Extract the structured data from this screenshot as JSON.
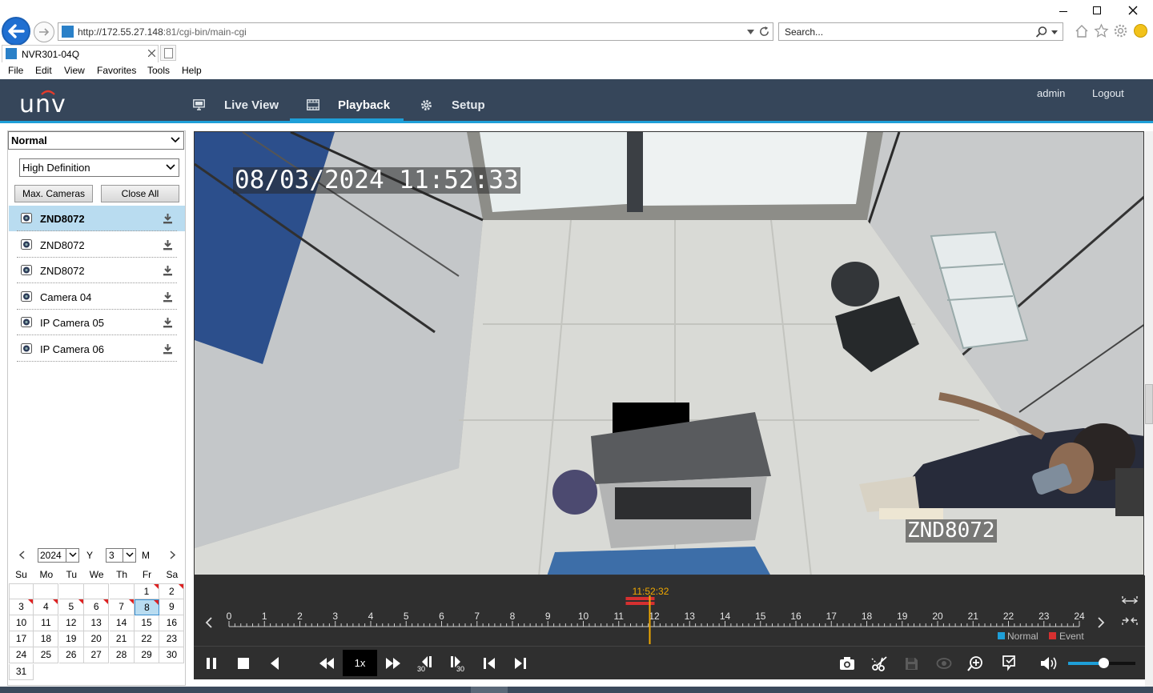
{
  "browser": {
    "url_host": "http://172.55.27.148",
    "url_rest": ":81/cgi-bin/main-cgi",
    "search_placeholder": "Search...",
    "tab_title": "NVR301-04Q",
    "menu": [
      "File",
      "Edit",
      "View",
      "Favorites",
      "Tools",
      "Help"
    ]
  },
  "app": {
    "logo": "unv",
    "nav": [
      {
        "label": "Live View",
        "icon": "monitor-icon"
      },
      {
        "label": "Playback",
        "icon": "film-icon",
        "active": true
      },
      {
        "label": "Setup",
        "icon": "gear-icon"
      }
    ],
    "user": "admin",
    "logout": "Logout"
  },
  "left": {
    "mode": "Normal",
    "quality": "High Definition",
    "max_cameras_label": "Max. Cameras",
    "close_all_label": "Close All",
    "cameras": [
      {
        "name": "ZND8072",
        "active": true
      },
      {
        "name": "ZND8072"
      },
      {
        "name": "ZND8072"
      },
      {
        "name": "Camera 04"
      },
      {
        "name": "IP Camera 05"
      },
      {
        "name": "IP Camera 06"
      }
    ]
  },
  "calendar": {
    "year": "2024",
    "year_suffix": "Y",
    "month": "3",
    "month_suffix": "M",
    "weekdays": [
      "Su",
      "Mo",
      "Tu",
      "We",
      "Th",
      "Fr",
      "Sa"
    ],
    "days": [
      "",
      "",
      "",
      "",
      "",
      "1",
      "2",
      "3",
      "4",
      "5",
      "6",
      "7",
      "8",
      "9",
      "10",
      "11",
      "12",
      "13",
      "14",
      "15",
      "16",
      "17",
      "18",
      "19",
      "20",
      "21",
      "22",
      "23",
      "24",
      "25",
      "26",
      "27",
      "28",
      "29",
      "30",
      "31"
    ],
    "recorded_days": [
      "1",
      "2",
      "3",
      "4",
      "5",
      "6",
      "7",
      "8"
    ],
    "selected_day": "8"
  },
  "video": {
    "timestamp_osd": "08/03/2024 11:52:33",
    "camera_osd": "ZND8072"
  },
  "timeline": {
    "current_time": "11:52:32",
    "hours": [
      "0",
      "1",
      "2",
      "3",
      "4",
      "5",
      "6",
      "7",
      "8",
      "9",
      "10",
      "11",
      "12",
      "13",
      "14",
      "15",
      "16",
      "17",
      "18",
      "19",
      "20",
      "21",
      "22",
      "23",
      "24"
    ],
    "legend_normal": "Normal",
    "legend_event": "Event",
    "colors": {
      "normal": "#1e9fd8",
      "event": "#d63030",
      "cursor": "#f0a800"
    }
  },
  "controls": {
    "speed": "1x",
    "skip_back_label": "30",
    "skip_fwd_label": "30",
    "volume_level": 0.52
  }
}
